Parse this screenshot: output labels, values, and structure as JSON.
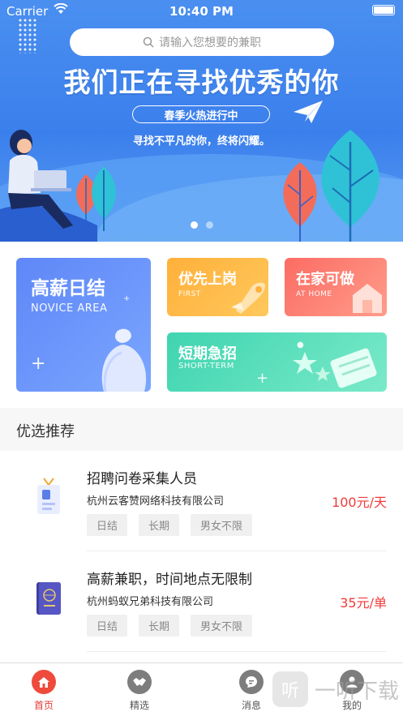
{
  "status_bar": {
    "carrier": "Carrier",
    "time": "10:40 PM"
  },
  "banner": {
    "search_placeholder": "请输入您想要的兼职",
    "title": "我们正在寻找优秀的你",
    "pill": "春季火热进行中",
    "subtitle": "寻找不平凡的你，终将闪耀。",
    "carousel_total": 2,
    "carousel_active": 1
  },
  "categories": [
    {
      "title": "高薪日结",
      "subtitle": "NOVICE AREA"
    },
    {
      "title": "优先上岗",
      "subtitle": "FIRST"
    },
    {
      "title": "在家可做",
      "subtitle": "AT HOME"
    },
    {
      "title": "短期急招",
      "subtitle": "SHORT-TERM"
    }
  ],
  "section_title": "优选推荐",
  "jobs": [
    {
      "title": "招聘问卷采集人员",
      "company": "杭州云客赞网络科技有限公司",
      "salary": "100元/天",
      "tags": [
        "日结",
        "长期",
        "男女不限"
      ]
    },
    {
      "title": "高薪兼职，时间地点无限制",
      "company": "杭州蚂蚁兄弟科技有限公司",
      "salary": "35元/单",
      "tags": [
        "日结",
        "长期",
        "男女不限"
      ]
    }
  ],
  "tabs": [
    {
      "label": "首页",
      "icon": "home-icon",
      "active": true
    },
    {
      "label": "精选",
      "icon": "handshake-icon",
      "active": false
    },
    {
      "label": "消息",
      "icon": "chat-icon",
      "active": false
    },
    {
      "label": "我的",
      "icon": "user-icon",
      "active": false
    }
  ],
  "watermark": {
    "text": "一听下载",
    "logo": "听"
  },
  "colors": {
    "primary_blue": "#3b7fec",
    "accent_red": "#f23a3a",
    "tab_active": "#ee4b3c"
  }
}
